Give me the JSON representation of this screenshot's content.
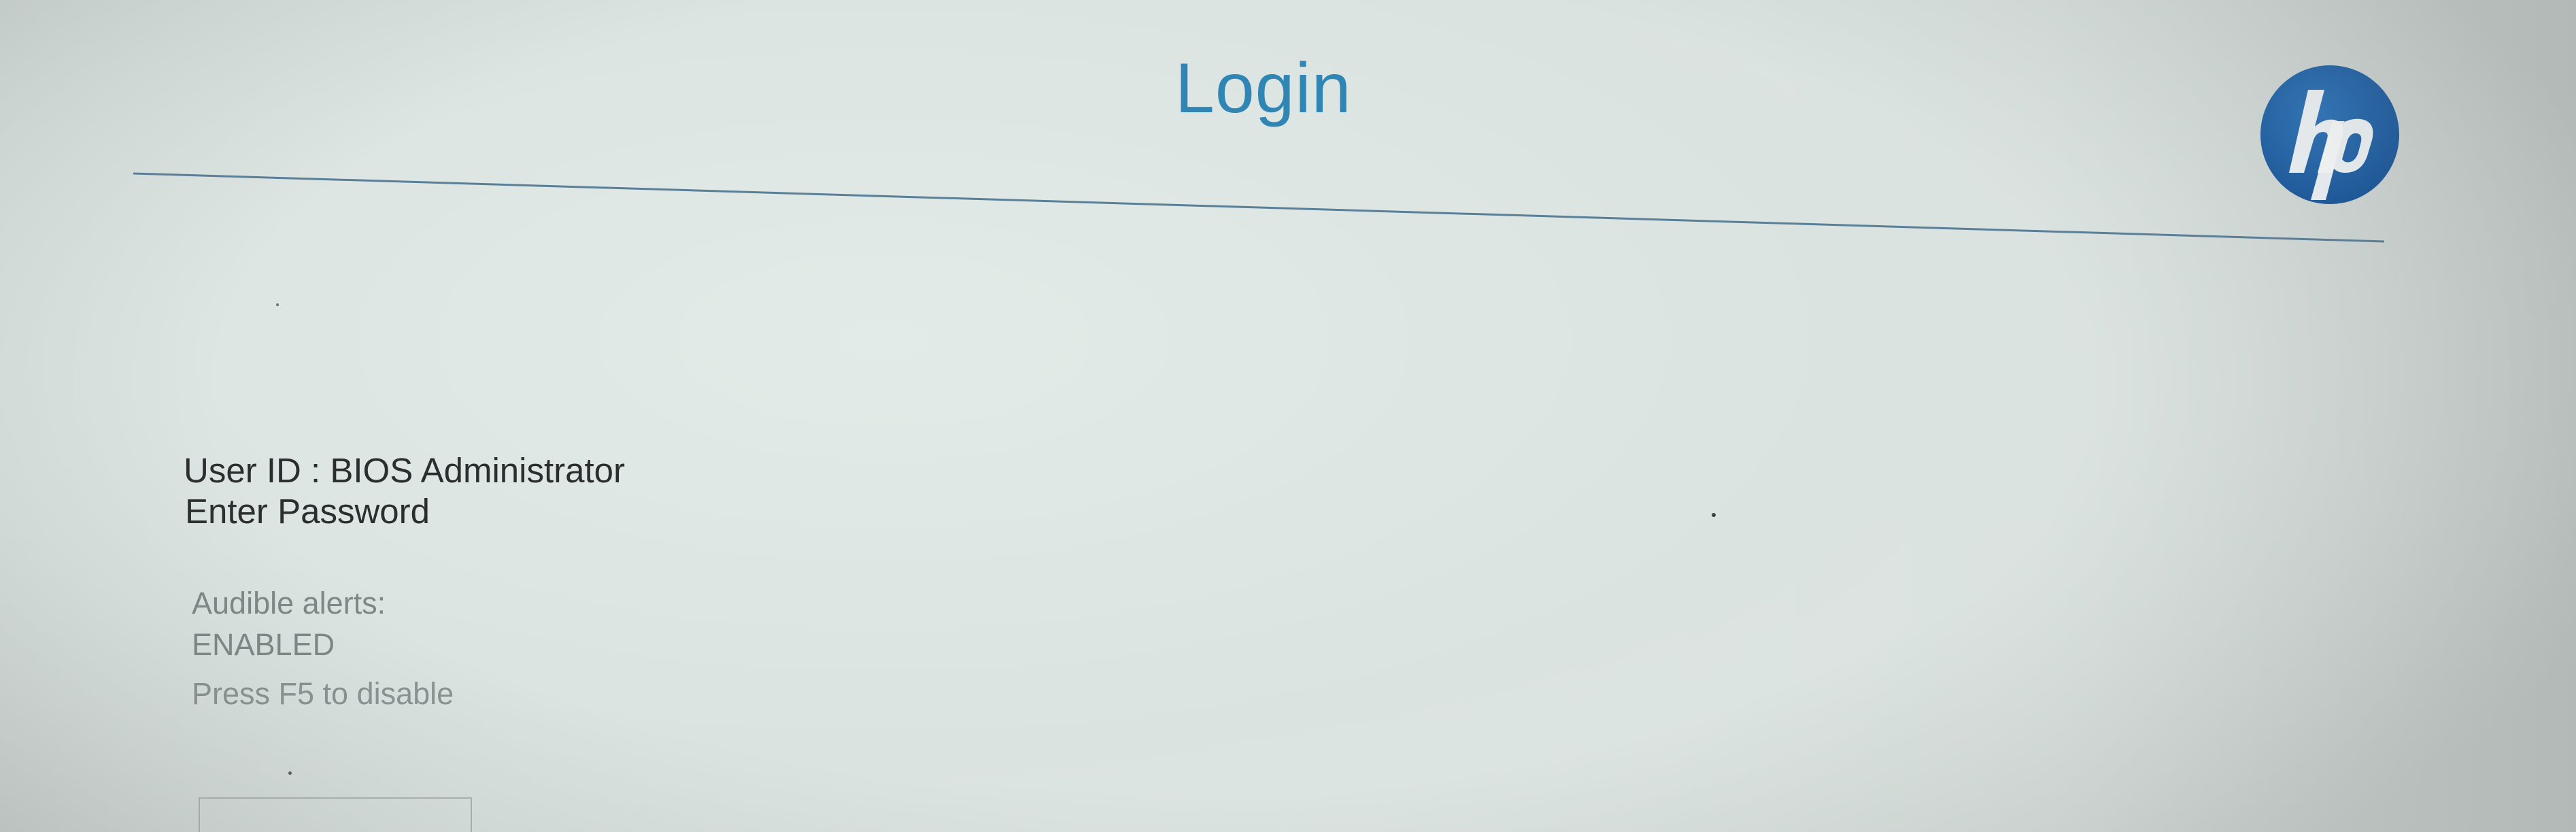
{
  "header": {
    "title": "Login",
    "logo_text": "hp",
    "accent_color": "#2f86b4",
    "logo_color": "#1a5fa4"
  },
  "login": {
    "user_id_line": "User ID : BIOS Administrator",
    "prompt": "Enter Password",
    "password_value": ""
  },
  "audible_alerts": {
    "label": "Audible alerts:",
    "state": "ENABLED",
    "hint": "Press F5 to disable"
  }
}
